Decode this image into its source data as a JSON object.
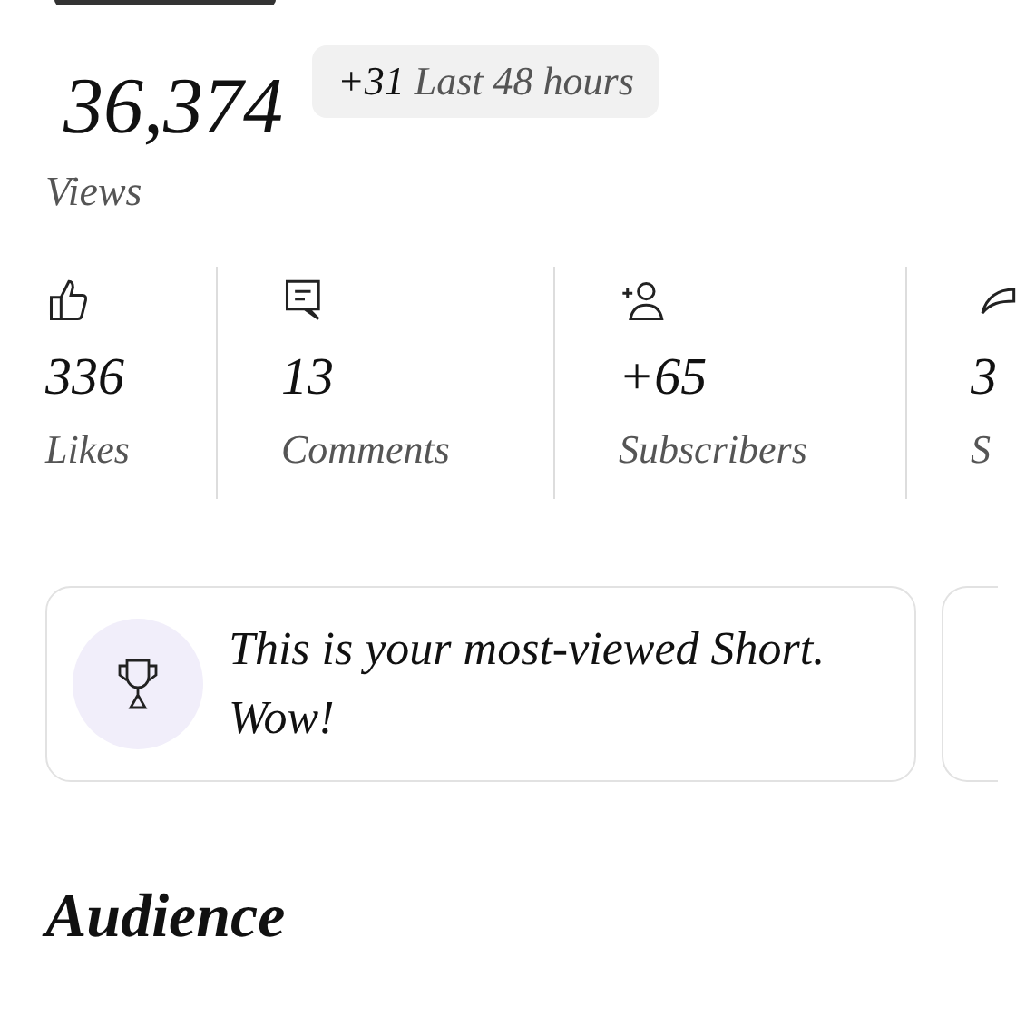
{
  "views": {
    "count": "36,374",
    "change": "+31",
    "period": "Last 48 hours",
    "label": "Views"
  },
  "stats": [
    {
      "kind": "likes",
      "value": "336",
      "label": "Likes"
    },
    {
      "kind": "comments",
      "value": "13",
      "label": "Comments"
    },
    {
      "kind": "subscribers",
      "value": "+65",
      "label": "Subscribers"
    },
    {
      "kind": "shares",
      "value": "3",
      "label": "S"
    }
  ],
  "highlight": {
    "text": "This is your most-viewed Short. Wow!"
  },
  "section_title": "Audience"
}
